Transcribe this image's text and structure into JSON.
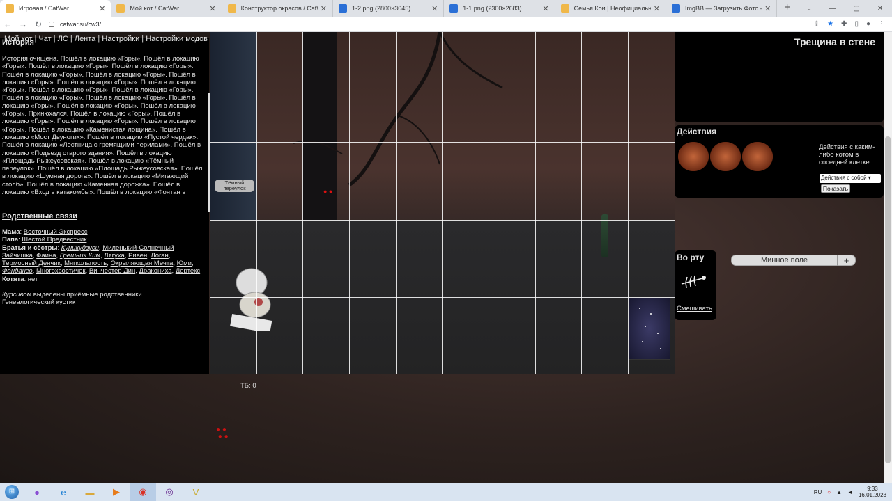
{
  "browser": {
    "tabs": [
      {
        "title": "Игровая / CatWar",
        "active": true,
        "icon": "catwar-favicon"
      },
      {
        "title": "Мой кот / CatWar",
        "active": false,
        "icon": "catwar-favicon"
      },
      {
        "title": "Конструктор окрасов / CatWar",
        "active": false,
        "icon": "catwar-favicon"
      },
      {
        "title": "1-2.png (2800×3045)",
        "active": false,
        "icon": "image-favicon"
      },
      {
        "title": "1-1.png (2300×2683)",
        "active": false,
        "icon": "image-favicon"
      },
      {
        "title": "Семья Кои | Неофициальная гр",
        "active": false,
        "icon": "catwar-favicon"
      },
      {
        "title": "ImgBB — Загрузить Фото — Хо",
        "active": false,
        "icon": "imgbb-favicon"
      }
    ],
    "url": "catwar.su/cw3/"
  },
  "topnav": {
    "items": [
      "Мой кот",
      "Чат",
      "ЛС",
      "Лента",
      "Настройки",
      "Настройки модов"
    ],
    "sep": "|"
  },
  "history": {
    "title": "История",
    "text": "История очищена. Пошёл в локацию «Горы». Пошёл в локацию «Горы». Пошёл в локацию «Горы». Пошёл в локацию «Горы». Пошёл в локацию «Горы». Пошёл в локацию «Горы». Пошёл в локацию «Горы». Пошёл в локацию «Горы». Пошёл в локацию «Горы». Пошёл в локацию «Горы». Пошёл в локацию «Горы». Пошёл в локацию «Горы». Пошёл в локацию «Горы». Пошёл в локацию «Горы». Пошёл в локацию «Горы». Пошёл в локацию «Горы». Принюхался. Пошёл в локацию «Горы». Пошёл в локацию «Горы». Пошёл в локацию «Горы». Пошёл в локацию «Горы». Пошёл в локацию «Каменистая лощина». Пошёл в локацию «Мост Двуногих». Пошёл в локацию «Пустой чердак». Пошёл в локацию «Лестница с гремящими перилами». Пошёл в локацию «Подъезд старого здания». Пошёл в локацию «Площадь Рыжеусовская». Пошёл в локацию «Тёмный переулок». Пошёл в локацию «Площадь Рыжеусовская». Пошёл в локацию «Шумная дорога». Пошёл в локацию «Мигающий столб». Пошёл в локацию «Каменная дорожка». Пошёл в локацию «Вход в катакомбы». Пошёл в локацию «Фонтан в"
  },
  "relatives": {
    "title": "Родственные связи",
    "mama_label": "Мама",
    "mama": "Восточный Экспресс",
    "papa_label": "Папа",
    "papa": "Шестой Предвестник",
    "siblings_label": "Братья и сёстры",
    "siblings": [
      {
        "name": "Куникудзуси",
        "adopted": true
      },
      {
        "name": "Миленький-Солнечный Зайчишка",
        "adopted": false
      },
      {
        "name": "Фаина",
        "adopted": false
      },
      {
        "name": "Грешник Ким",
        "adopted": true
      },
      {
        "name": "Лягуха",
        "adopted": false
      },
      {
        "name": "Ривен",
        "adopted": false
      },
      {
        "name": "Логан",
        "adopted": false
      },
      {
        "name": "Термосный Денчик",
        "adopted": false
      },
      {
        "name": "Мягколапость",
        "adopted": false
      },
      {
        "name": "Окрыляющая Мечта",
        "adopted": false
      },
      {
        "name": "Юми",
        "adopted": false
      },
      {
        "name": "Фанданго",
        "adopted": true
      },
      {
        "name": "Многохвостичек",
        "adopted": false
      },
      {
        "name": "Винчестер Дин",
        "adopted": false
      },
      {
        "name": "Дракониха",
        "adopted": false
      },
      {
        "name": "Дертекс",
        "adopted": false
      }
    ],
    "kittens_label": "Котята",
    "kittens": "нет",
    "note_italic": "Курсивом",
    "note_rest": " выделены приёмные родственники.",
    "tree_link": "Генеалогический кустик"
  },
  "game": {
    "dark_lane_label": "Тёмный переулок",
    "tb_label": "ТБ: 0"
  },
  "location": {
    "title": "Трещина в стене"
  },
  "actions": {
    "title": "Действия",
    "icons": [
      "cat-action-1-icon",
      "cat-action-2-icon",
      "cat-action-3-icon"
    ],
    "note": "Действия с каким-либо котом в соседней клетке:",
    "select_value": "Действия с собой",
    "show_button": "Показать"
  },
  "mouth": {
    "title": "Во рту",
    "mix_link": "Смешивать"
  },
  "mines": {
    "label": "Минное поле",
    "plus": "+"
  },
  "taskbar": {
    "lang": "RU",
    "time": "9:33",
    "date": "16.01.2023"
  },
  "colors": {
    "panel_bg": "#000000",
    "grid_line": "#ffffff",
    "tab_bar": "#dee1e6",
    "taskbar": "#d9e4f1"
  }
}
